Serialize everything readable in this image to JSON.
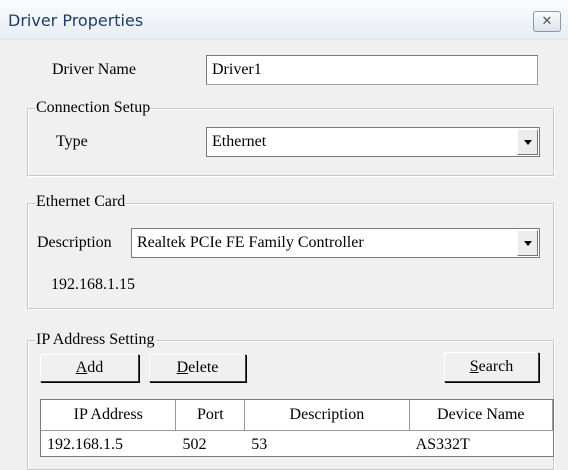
{
  "window": {
    "title": "Driver Properties",
    "close_icon": "close-icon"
  },
  "driver": {
    "name_label": "Driver Name",
    "name_value": "Driver1"
  },
  "connection": {
    "group_label": "Connection Setup",
    "type_label": "Type",
    "type_value": "Ethernet"
  },
  "ethernet": {
    "group_label": "Ethernet Card",
    "description_label": "Description",
    "description_value": "Realtek PCIe FE Family Controller",
    "ip_text": "192.168.1.15"
  },
  "ip_setting": {
    "group_label": "IP Address Setting",
    "add_label": "Add",
    "delete_label": "Delete",
    "search_label": "Search",
    "columns": [
      "IP Address",
      "Port",
      "Description",
      "Device Name"
    ],
    "rows": [
      [
        "192.168.1.5",
        "502",
        "53",
        "AS332T"
      ]
    ]
  }
}
